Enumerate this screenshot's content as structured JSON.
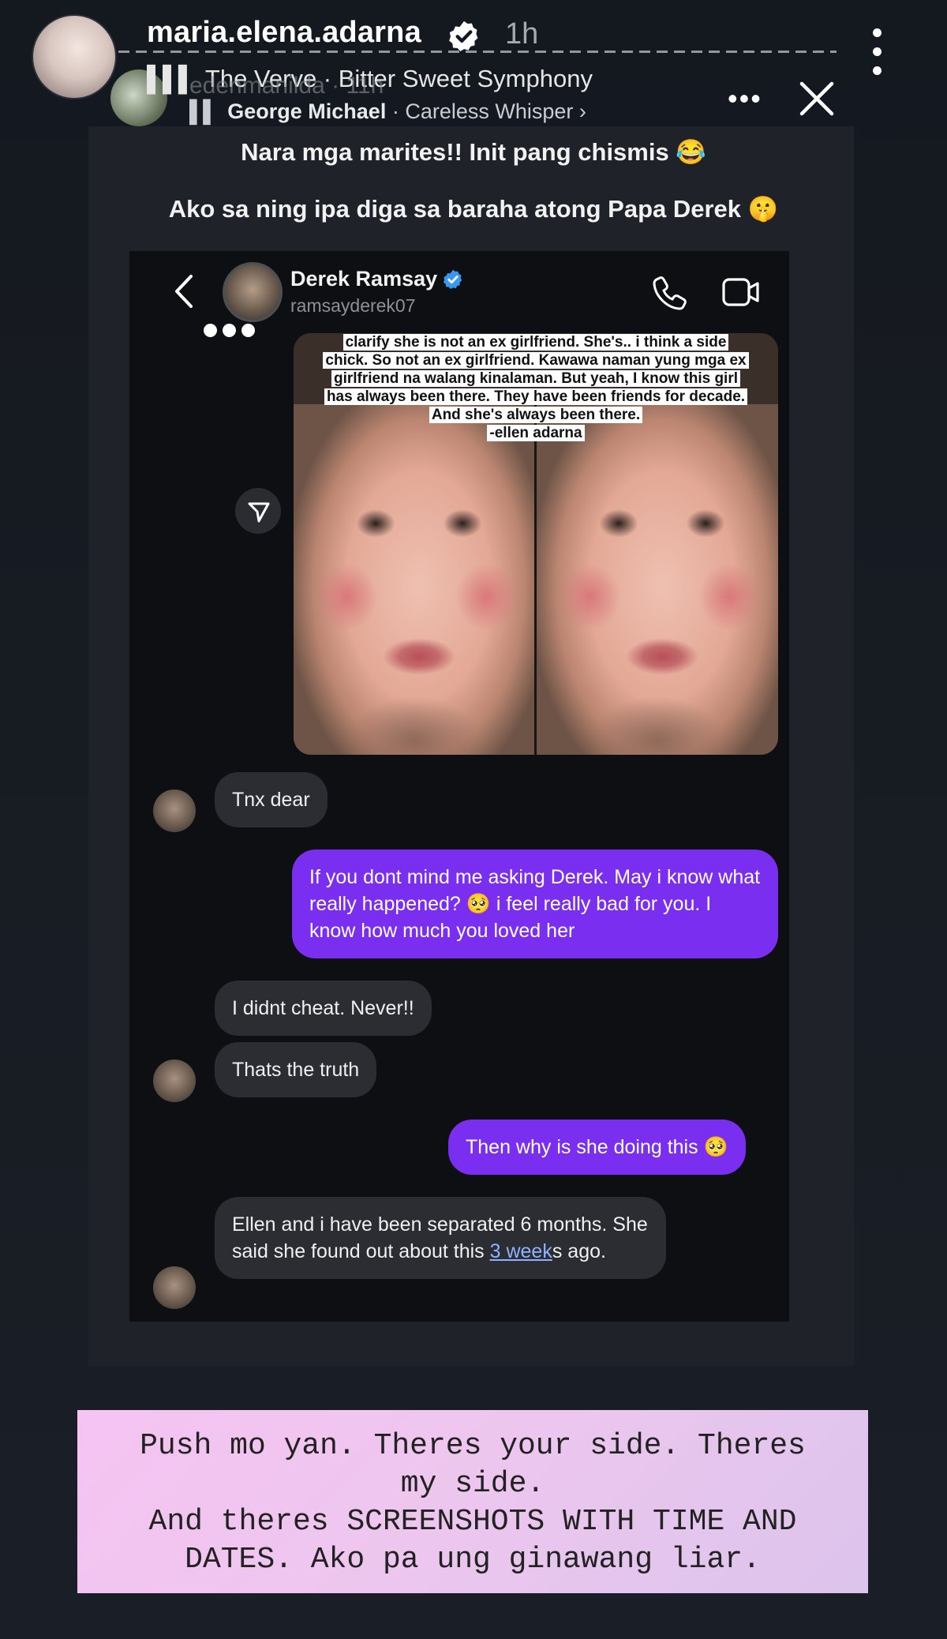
{
  "story": {
    "username": "maria.elena.adarna",
    "time": "1h",
    "caption_line1": "Nara mga marites!! Init pang chismis 😂",
    "caption_line2": "Ako sa ning ipa diga sa baraha atong Papa Derek 🤫",
    "music_primary": "The Verve · Bitter Sweet Symphony",
    "music_ghost": "edenmanilda · 11h",
    "music_secondary_artist": "George Michael",
    "music_secondary_song": " · Careless Whisper ›",
    "bottom_note": "Push mo yan. Theres your side. Theres\nmy side.\nAnd theres SCREENSHOTS WITH TIME AND\nDATES. Ako pa ung ginawang liar."
  },
  "chat": {
    "contact_name": "Derek Ramsay",
    "contact_handle": "ramsayderek07",
    "forwarded_image_text": [
      "clarify she is not an ex girlfriend. She's.. i think a side",
      "chick. So not an ex girlfriend. Kawawa naman yung mga ex",
      "girlfriend na walang kinalaman. But yeah, I know this girl",
      "has always been there. They have been friends for decade.",
      "And she's always been there.",
      "-ellen adarna"
    ],
    "messages": [
      {
        "from": "them",
        "text": "Tnx dear"
      },
      {
        "from": "me",
        "text": "If you dont mind me asking Derek. May i know what really happened? 🥺 i feel really bad for you. I know how much you loved her"
      },
      {
        "from": "them",
        "text": "I didnt cheat. Never!!"
      },
      {
        "from": "them",
        "text": "Thats the truth"
      },
      {
        "from": "me",
        "text": "Then why is she doing this 🥺"
      },
      {
        "from": "them",
        "text_before": "Ellen and i have been separated 6 months. She said she found out about this ",
        "link": "3 week",
        "text_after": "s ago."
      }
    ]
  },
  "colors": {
    "outgoing_bubble": "#7a2ff0",
    "incoming_bubble": "#2b2d33",
    "note_background": "#f6c4f2",
    "verified_badge": "#3897f0"
  },
  "icons": [
    "verified-badge-icon",
    "more-vertical-icon",
    "close-icon",
    "more-horizontal-icon",
    "back-arrow-icon",
    "phone-icon",
    "video-camera-icon",
    "share-icon",
    "music-bars-icon"
  ]
}
